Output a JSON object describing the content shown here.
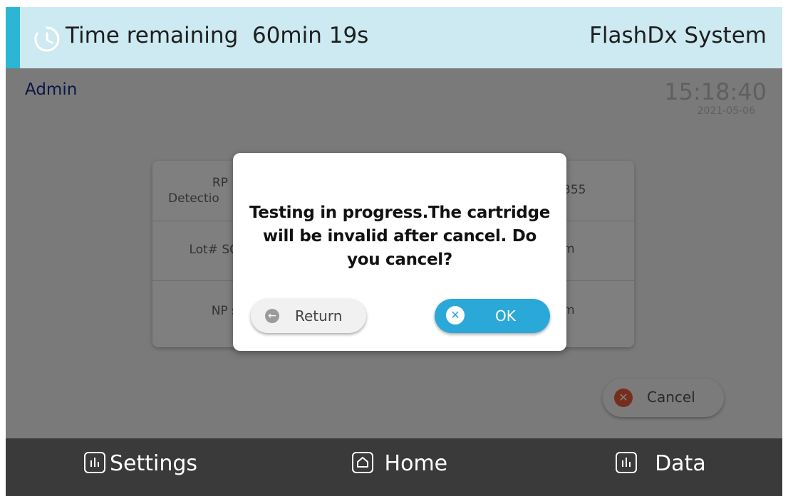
{
  "header": {
    "time_remaining_label": "Time remaining",
    "time_remaining_value": "60min 19s",
    "system_name": "FlashDx System"
  },
  "user": {
    "name": "Admin"
  },
  "clock": {
    "time": "15:18:40",
    "date": "2021-05-06"
  },
  "info_rows": [
    {
      "label_line1": "RP",
      "label_line2": "Detectio",
      "value": "355"
    },
    {
      "label": "Lot# SC",
      "value": "m"
    },
    {
      "label": "NP s",
      "value": "m"
    }
  ],
  "background_cancel": {
    "label": "Cancel"
  },
  "dialog": {
    "message": "Testing in progress.The cartridge will be invalid after cancel.  Do you cancel?",
    "return_label": "Return",
    "ok_label": "OK"
  },
  "footer": {
    "settings_label": "Settings",
    "home_label": "Home",
    "data_label": "Data"
  },
  "colors": {
    "header_bg": "#cde9f1",
    "accent": "#2db6d3",
    "ok_button": "#2aa9d9",
    "cancel_icon": "#ef5a3c",
    "footer_bg": "#3a3a3a"
  }
}
